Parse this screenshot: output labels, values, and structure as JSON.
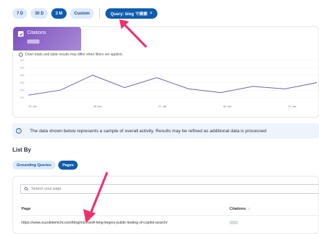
{
  "range_buttons": [
    "7 D",
    "30 D",
    "3 M",
    "Custom"
  ],
  "active_range": "3 M",
  "query_filter": {
    "label": "Query: bing で検索",
    "close": "×"
  },
  "metric": {
    "label": "Citations",
    "checked": true
  },
  "chart_note": "Chart totals and table results may differ when filters are applied.",
  "chart_data": {
    "type": "line",
    "title": "",
    "xlabel": "",
    "ylabel": "",
    "x_ticks": [
      "20 Jan",
      "28 Jan",
      "07 Jan",
      "06 Jan",
      "01 Jan"
    ],
    "series": [
      {
        "color": "#6b5fb5",
        "values": [
          2,
          6,
          18,
          8,
          16,
          7,
          4,
          9,
          7,
          12
        ]
      }
    ],
    "ylim": [
      0,
      30
    ],
    "grid": true
  },
  "banner": {
    "text": "The data shown below represents a sample of overall activity. Results may be refined as additional data is processed"
  },
  "list_by": {
    "title": "List By",
    "tabs": [
      "Grounding Queries",
      "Pages"
    ],
    "active_tab": "Pages"
  },
  "table": {
    "search_placeholder": "Search your page",
    "columns": {
      "page": "Page",
      "citations": "Citations"
    },
    "sort_indicator": "↓",
    "rows": [
      {
        "url": "https://www.suzukikenichi.com/blog/microsoft-bing-begins-public-testing-of-copilot-search/"
      }
    ]
  },
  "colors": {
    "accent": "#0f5cad",
    "pill_bg": "#dbeafe",
    "annotation": "#f0306a",
    "metric_tile": "#7a4fbd"
  }
}
